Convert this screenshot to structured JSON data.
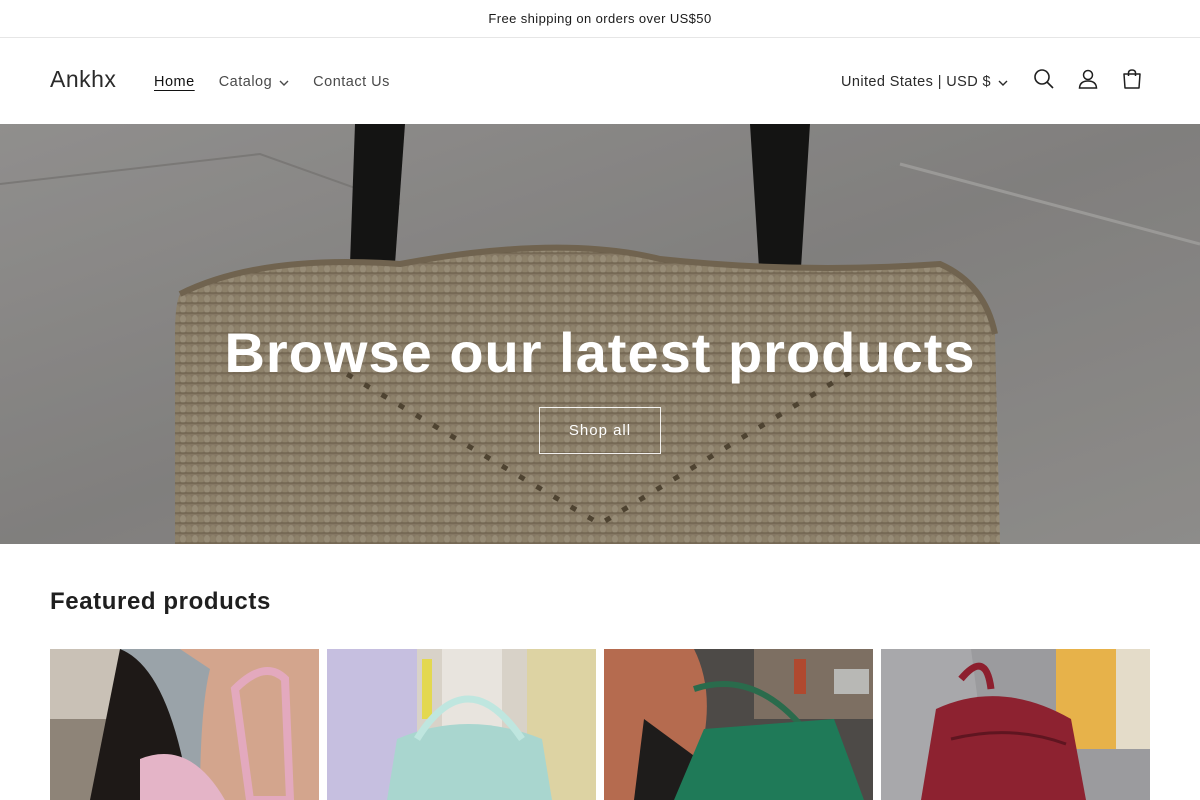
{
  "announcement": {
    "text": "Free shipping on orders over US$50"
  },
  "header": {
    "logo": "Ankhx",
    "nav": [
      {
        "label": "Home",
        "active": true
      },
      {
        "label": "Catalog",
        "dropdown": true
      },
      {
        "label": "Contact Us"
      }
    ],
    "locale": "United States | USD $",
    "icons": [
      "search-icon",
      "account-icon",
      "cart-icon"
    ]
  },
  "hero": {
    "title": "Browse our latest products",
    "button_label": "Shop all"
  },
  "featured": {
    "title": "Featured products",
    "products": [
      {
        "image": "pink-shoulder-bag-photo"
      },
      {
        "image": "mint-jelly-tote-photo"
      },
      {
        "image": "green-woven-tote-photo"
      },
      {
        "image": "red-floral-backpack-photo"
      }
    ]
  },
  "colors": {
    "text": "#121212",
    "hero_overlay": "rgba(0,0,0,0.28)",
    "button_border": "#ffffff"
  }
}
